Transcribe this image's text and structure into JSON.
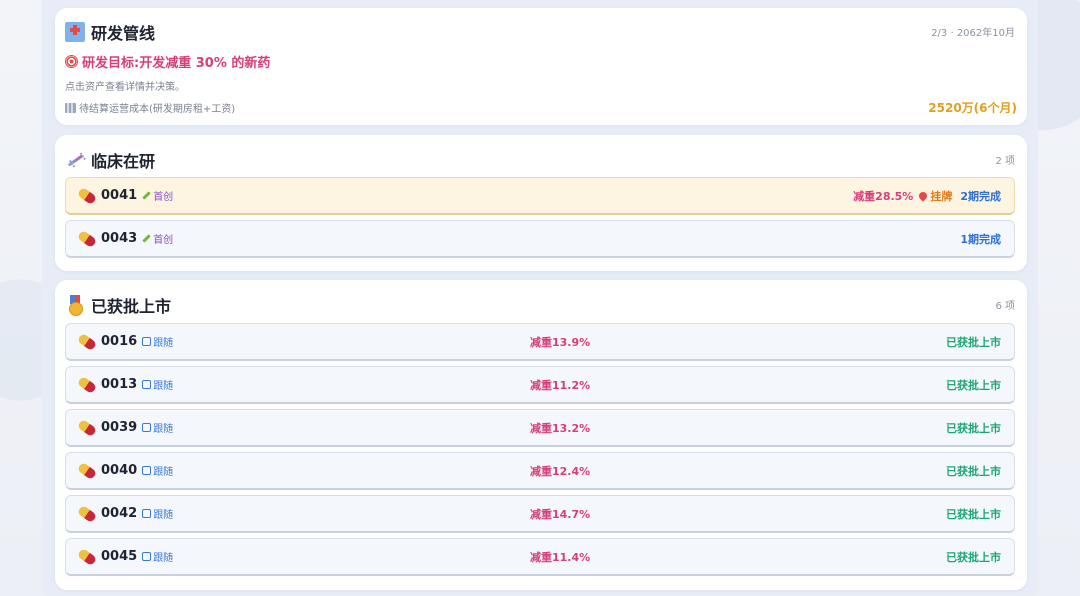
{
  "pipeline": {
    "title": "研发管线",
    "meta": "2/3 · 2062年10月",
    "goal": "研发目标:开发减重 30% 的新药",
    "hint": "点击资产查看详情并决策。",
    "cost_label": "待结算运营成本(研发期房租+工资)",
    "cost_amount": "2520万(6个月)"
  },
  "clinical": {
    "title": "临床在研",
    "count": "2 项",
    "rows": [
      {
        "id": "0041",
        "tag": "首创",
        "reduction": "减重28.5%",
        "pin": "挂牌",
        "status": "2期完成"
      },
      {
        "id": "0043",
        "tag": "首创",
        "status": "1期完成"
      }
    ]
  },
  "approved": {
    "title": "已获批上市",
    "count": "6 项",
    "rows": [
      {
        "id": "0016",
        "tag": "跟随",
        "reduction": "减重13.9%",
        "status": "已获批上市"
      },
      {
        "id": "0013",
        "tag": "跟随",
        "reduction": "减重11.2%",
        "status": "已获批上市"
      },
      {
        "id": "0039",
        "tag": "跟随",
        "reduction": "减重13.2%",
        "status": "已获批上市"
      },
      {
        "id": "0040",
        "tag": "跟随",
        "reduction": "减重12.4%",
        "status": "已获批上市"
      },
      {
        "id": "0042",
        "tag": "跟随",
        "reduction": "减重14.7%",
        "status": "已获批上市"
      },
      {
        "id": "0045",
        "tag": "跟随",
        "reduction": "减重11.4%",
        "status": "已获批上市"
      }
    ]
  },
  "icons": {
    "pipeline": "hospital-icon",
    "clinical": "dna-icon",
    "approved": "medal-icon",
    "goal": "target-icon",
    "cost": "building-icon",
    "drug": "pill-icon",
    "original": "pencil-icon",
    "follow": "repeat-icon",
    "pin": "pin-icon"
  },
  "colors": {
    "goal": "#d6407a",
    "cost": "#e0a020",
    "approved_status": "#1ea672",
    "clinical_status": "#2e6fd6"
  }
}
